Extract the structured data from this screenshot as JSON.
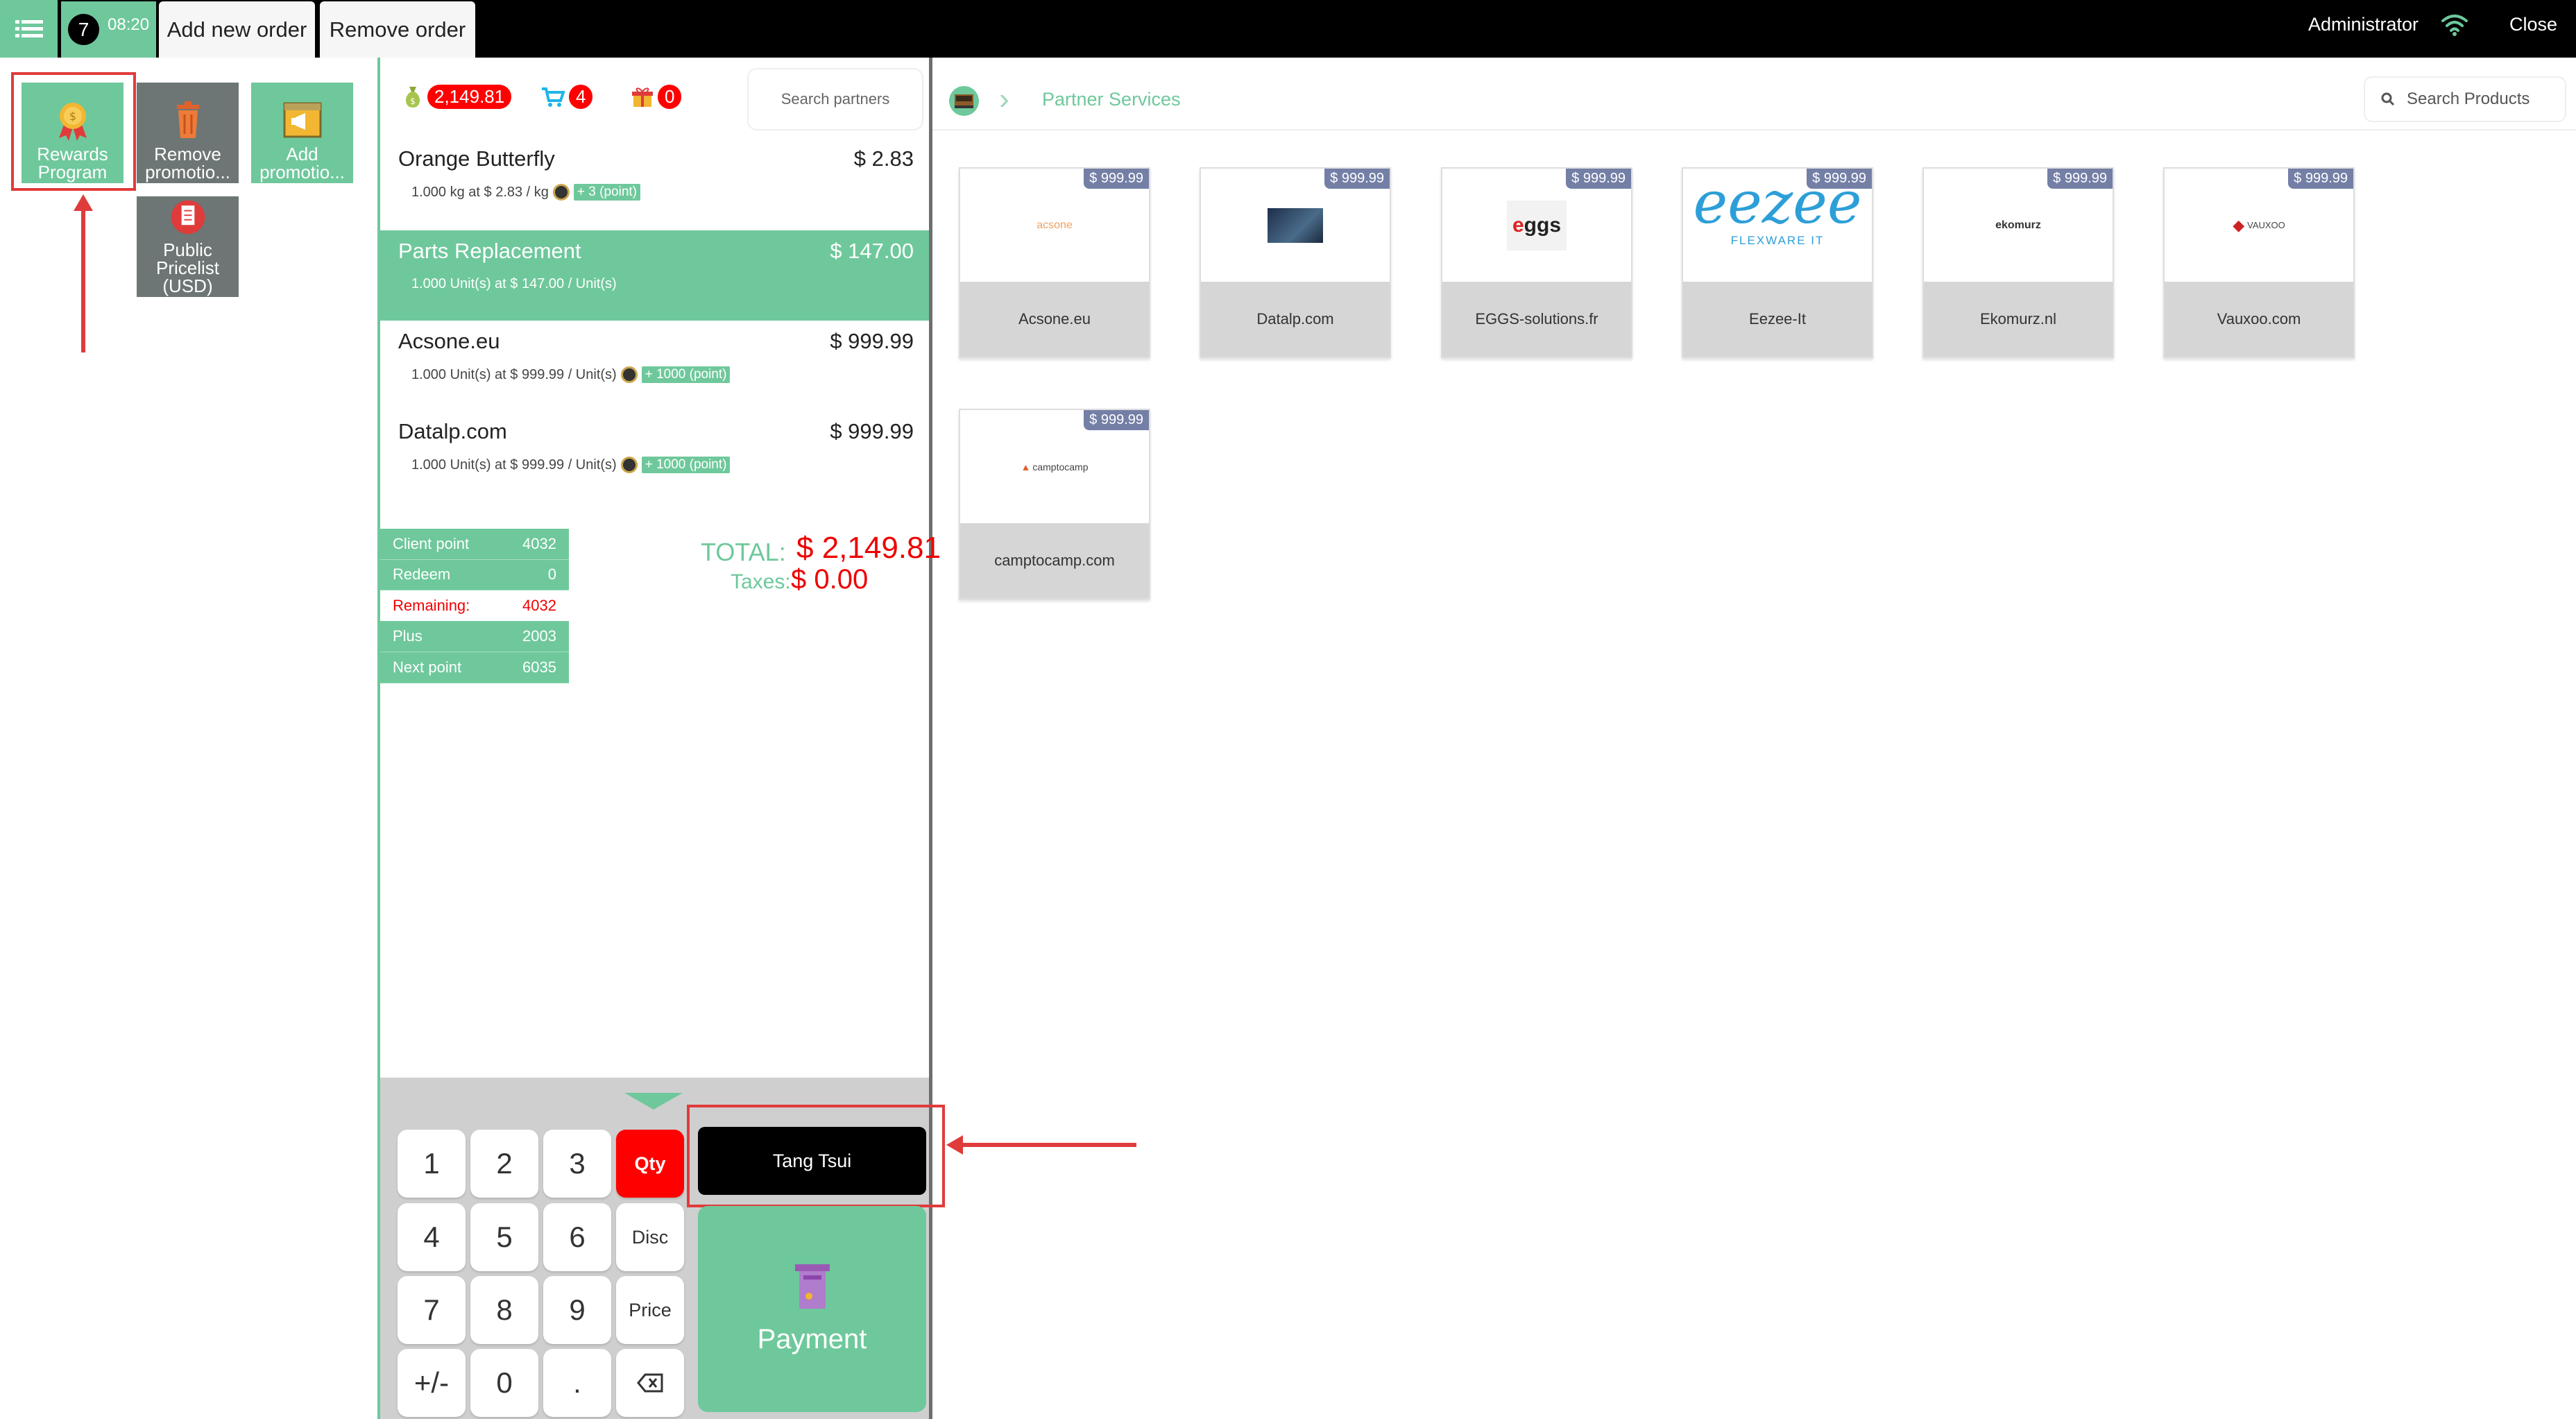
{
  "header": {
    "order_number": "7",
    "order_time": "08:20",
    "add_order_label": "Add new order",
    "remove_order_label": "Remove order",
    "user_name": "Administrator",
    "close_label": "Close"
  },
  "actions": {
    "rewards_program": "Rewards Program",
    "remove_promotion": "Remove promotio...",
    "add_promotion": "Add promotio...",
    "public_pricelist": "Public Pricelist (USD)"
  },
  "order_summary": {
    "amount": "2,149.81",
    "cart_count": "4",
    "gift_count": "0",
    "search_placeholder": "Search partners"
  },
  "order_lines": [
    {
      "name": "Orange Butterfly",
      "price": "$ 2.83",
      "detail": "1.000 kg at $ 2.83 / kg",
      "points": "+ 3 (point)"
    },
    {
      "name": "Parts Replacement",
      "price": "$ 147.00",
      "detail": "1.000 Unit(s) at $ 147.00 / Unit(s)",
      "points": ""
    },
    {
      "name": "Acsone.eu",
      "price": "$ 999.99",
      "detail": "1.000 Unit(s) at $ 999.99 / Unit(s)",
      "points": "+ 1000 (point)"
    },
    {
      "name": "Datalp.com",
      "price": "$ 999.99",
      "detail": "1.000 Unit(s) at $ 999.99 / Unit(s)",
      "points": "+ 1000 (point)"
    }
  ],
  "loyalty": [
    {
      "label": "Client point",
      "value": "4032"
    },
    {
      "label": "Redeem",
      "value": "0"
    },
    {
      "label": "Remaining:",
      "value": "4032"
    },
    {
      "label": "Plus",
      "value": "2003"
    },
    {
      "label": "Next point",
      "value": "6035"
    }
  ],
  "totals": {
    "total_label": "TOTAL:",
    "total_value": "$ 2,149.81",
    "taxes_label": "Taxes:",
    "taxes_value": "$ 0.00"
  },
  "numpad": {
    "keys": [
      "1",
      "2",
      "3",
      "4",
      "5",
      "6",
      "7",
      "8",
      "9",
      "+/-",
      "0",
      "."
    ],
    "qty": "Qty",
    "disc": "Disc",
    "price": "Price"
  },
  "customer_name": "Tang Tsui",
  "payment_label": "Payment",
  "breadcrumb": {
    "category": "Partner Services"
  },
  "search_products_placeholder": "Search Products",
  "products": [
    {
      "name": "Acsone.eu",
      "price": "$ 999.99",
      "logo": "acsone"
    },
    {
      "name": "Datalp.com",
      "price": "$ 999.99",
      "logo": ""
    },
    {
      "name": "EGGS-solutions.fr",
      "price": "$ 999.99",
      "logo": "eggs"
    },
    {
      "name": "Eezee-It",
      "price": "$ 999.99",
      "logo": "eezee"
    },
    {
      "name": "Ekomurz.nl",
      "price": "$ 999.99",
      "logo": "ekomurz"
    },
    {
      "name": "Vauxoo.com",
      "price": "$ 999.99",
      "logo": "VAUXOO"
    },
    {
      "name": "camptocamp.com",
      "price": "$ 999.99",
      "logo": "camptocamp"
    }
  ],
  "eezee_tagline": "FLEXWARE IT",
  "colors": {
    "accent": "#6ec89b",
    "alert": "#ff0000",
    "price_badge": "#747fa6",
    "annotation": "#e03b3b"
  }
}
